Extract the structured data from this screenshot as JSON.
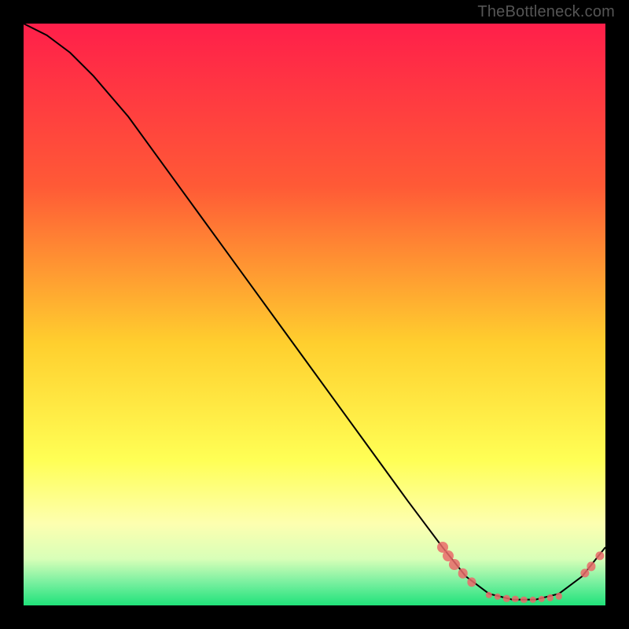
{
  "watermark": "TheBottleneck.com",
  "colors": {
    "bg_black": "#000000",
    "grad_top": "#ff1f4a",
    "grad_mid1": "#ff7a2e",
    "grad_mid2": "#ffd72e",
    "grad_mid3": "#ffff55",
    "grad_low": "#fbffa6",
    "grad_green": "#20e27a",
    "line": "#000000",
    "dot": "#ea6a6a"
  },
  "chart_data": {
    "type": "line",
    "title": "",
    "xlabel": "",
    "ylabel": "",
    "xlim": [
      0,
      100
    ],
    "ylim": [
      0,
      100
    ],
    "series": [
      {
        "name": "curve",
        "x": [
          0,
          4,
          8,
          12,
          18,
          26,
          34,
          42,
          50,
          58,
          66,
          72,
          76,
          80,
          84,
          88,
          92,
          96,
          100
        ],
        "y": [
          100,
          98,
          95,
          91,
          84,
          73,
          62,
          51,
          40,
          29,
          18,
          10,
          5,
          2,
          1,
          1,
          2,
          5,
          10
        ]
      }
    ],
    "points": [
      {
        "x": 72,
        "y": 10,
        "size": 10
      },
      {
        "x": 73,
        "y": 8.5,
        "size": 10
      },
      {
        "x": 74,
        "y": 7,
        "size": 10
      },
      {
        "x": 75.5,
        "y": 5.5,
        "size": 9
      },
      {
        "x": 77,
        "y": 4,
        "size": 8
      },
      {
        "x": 80,
        "y": 1.8,
        "size": 6
      },
      {
        "x": 81.5,
        "y": 1.5,
        "size": 6
      },
      {
        "x": 83,
        "y": 1.2,
        "size": 6
      },
      {
        "x": 84.5,
        "y": 1.1,
        "size": 6
      },
      {
        "x": 86,
        "y": 1.0,
        "size": 6
      },
      {
        "x": 87.5,
        "y": 1.0,
        "size": 6
      },
      {
        "x": 89,
        "y": 1.1,
        "size": 6
      },
      {
        "x": 90.5,
        "y": 1.3,
        "size": 6
      },
      {
        "x": 92,
        "y": 1.6,
        "size": 6
      },
      {
        "x": 96.5,
        "y": 5.5,
        "size": 8
      },
      {
        "x": 97.5,
        "y": 6.7,
        "size": 8
      },
      {
        "x": 99,
        "y": 8.5,
        "size": 8
      }
    ],
    "gradient_bands": [
      {
        "from": 0,
        "to": 80,
        "top_color": "#ff1f4a",
        "bottom_color": "#ffff55"
      },
      {
        "from": 80,
        "to": 90,
        "top_color": "#ffff55",
        "bottom_color": "#fbffa6"
      },
      {
        "from": 90,
        "to": 100,
        "top_color": "#fbffa6",
        "bottom_color": "#20e27a"
      }
    ]
  }
}
